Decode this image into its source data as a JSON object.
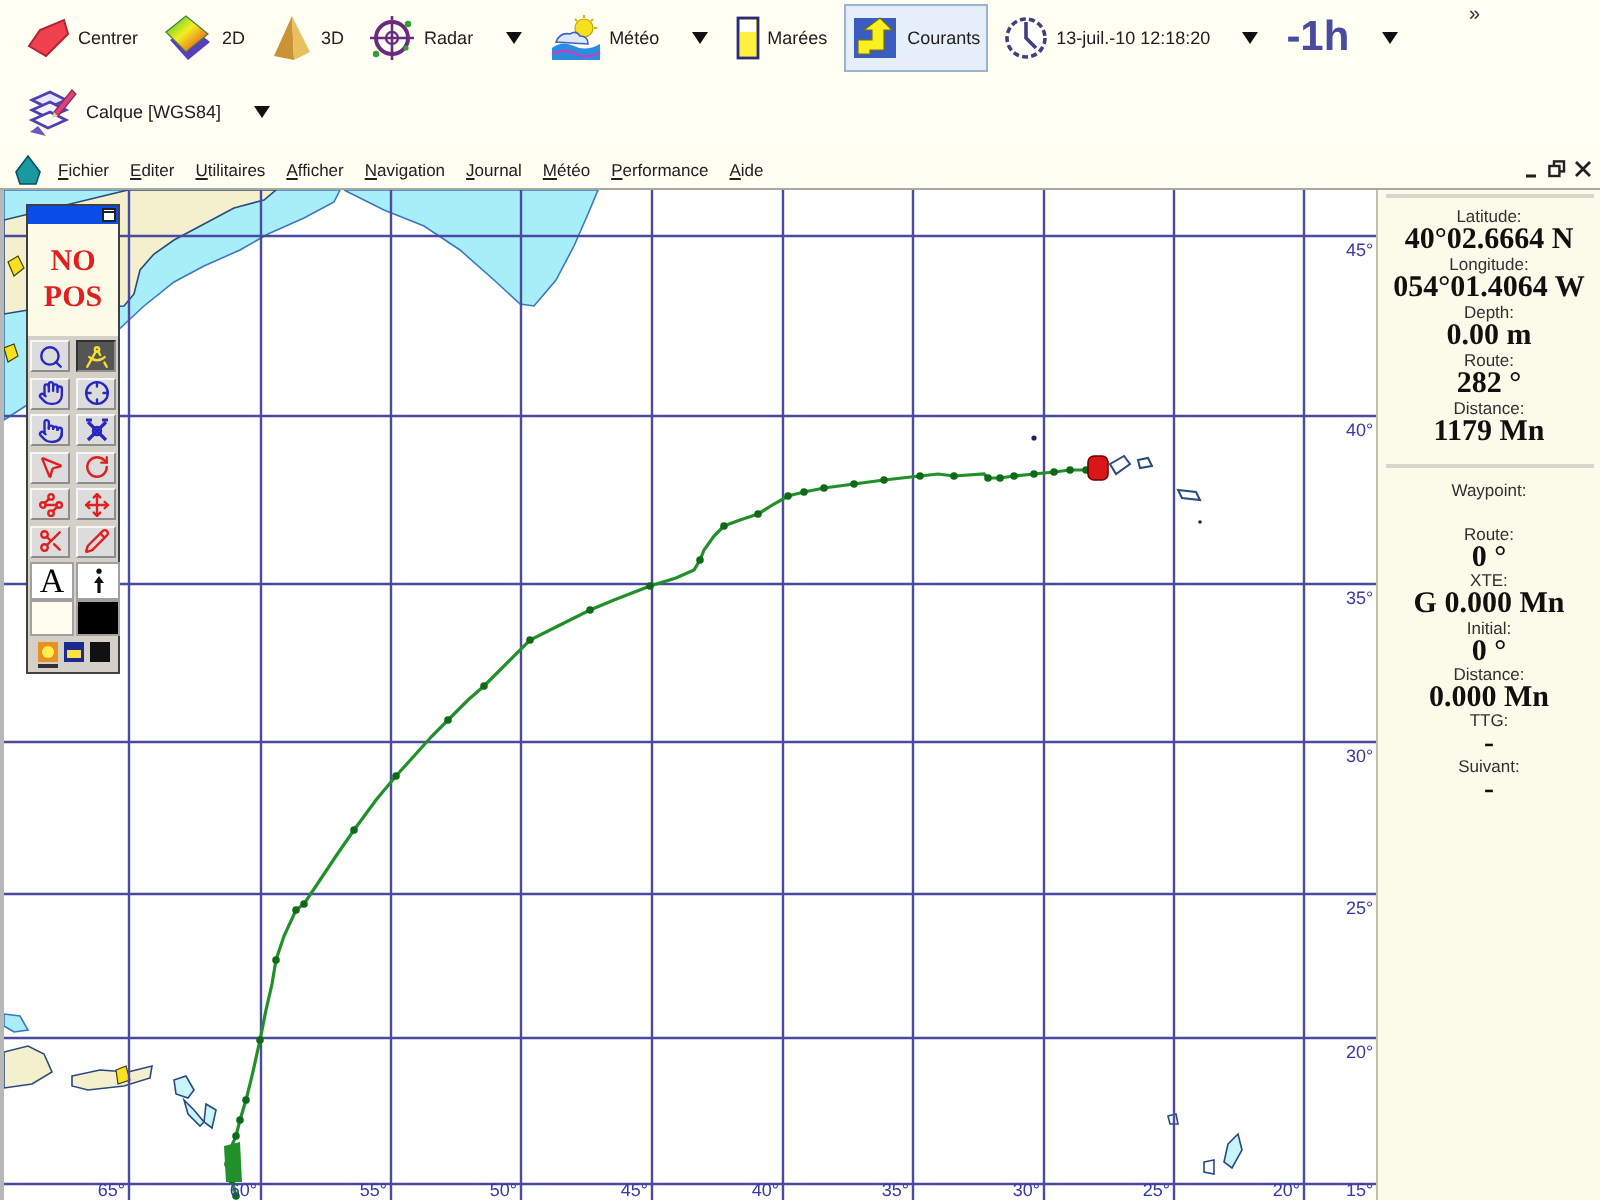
{
  "toolbar": {
    "buttons": [
      {
        "kind": "center",
        "label": "Centrer",
        "dropdown": false,
        "selected": false
      },
      {
        "kind": "chart-2d",
        "label": "2D",
        "dropdown": false,
        "selected": false
      },
      {
        "kind": "chart-3d",
        "label": "3D",
        "dropdown": false,
        "selected": false
      },
      {
        "kind": "radar",
        "label": "Radar",
        "dropdown": true,
        "selected": false
      },
      {
        "kind": "weather",
        "label": "Météo",
        "dropdown": true,
        "selected": false
      },
      {
        "kind": "tides",
        "label": "Marées",
        "dropdown": false,
        "selected": false
      },
      {
        "kind": "currents",
        "label": "Courants",
        "dropdown": false,
        "selected": true
      },
      {
        "kind": "clock",
        "label": "13-juil.-10 12:18:20",
        "dropdown": true,
        "selected": false
      },
      {
        "kind": "offset",
        "label": "-1h",
        "dropdown": true,
        "selected": false
      }
    ],
    "overflow": "»",
    "second_row": [
      {
        "kind": "layer",
        "label": "Calque [WGS84]",
        "dropdown": true,
        "selected": false
      }
    ]
  },
  "menu": {
    "items": [
      "Fichier",
      "Editer",
      "Utilitaires",
      "Afficher",
      "Navigation",
      "Journal",
      "Météo",
      "Performance",
      "Aide"
    ]
  },
  "map": {
    "longitude_labels": [
      "65°",
      "60°",
      "55°",
      "50°",
      "45°",
      "40°",
      "35°",
      "30°",
      "25°",
      "20°"
    ],
    "latitude_labels": [
      "45°",
      "40°",
      "35°",
      "30°",
      "25°",
      "20°",
      "15°"
    ]
  },
  "palette": {
    "status": "NO POS",
    "tools": [
      {
        "kind": "zoom",
        "selected": false
      },
      {
        "kind": "dividers",
        "selected": true
      },
      {
        "kind": "pan",
        "selected": false
      },
      {
        "kind": "center",
        "selected": false
      },
      {
        "kind": "point",
        "selected": false
      },
      {
        "kind": "mark",
        "selected": false
      },
      {
        "kind": "arrow",
        "selected": false
      },
      {
        "kind": "rotate",
        "selected": false
      },
      {
        "kind": "waypoints",
        "selected": false
      },
      {
        "kind": "move",
        "selected": false
      },
      {
        "kind": "cut",
        "selected": false
      },
      {
        "kind": "pencil",
        "selected": false
      }
    ],
    "text_tool": "A",
    "swatches": [
      {
        "color": "#fffdf0"
      },
      {
        "color": "#000000"
      }
    ],
    "modes": [
      {
        "kind": "day",
        "selected": true
      },
      {
        "kind": "dusk",
        "selected": false
      },
      {
        "kind": "night",
        "selected": false
      }
    ]
  },
  "info_panel": {
    "position": [
      {
        "label": "Latitude:",
        "value": "40°02.6664 N"
      },
      {
        "label": "Longitude:",
        "value": "054°01.4064 W"
      },
      {
        "label": "Depth:",
        "value": "0.00 m"
      },
      {
        "label": "Route:",
        "value": "282 °"
      },
      {
        "label": "Distance:",
        "value": "1179 Mn"
      }
    ],
    "waypoint": {
      "title": "Waypoint:",
      "readouts": [
        {
          "label": "Route:",
          "value": "0 °"
        },
        {
          "label": "XTE:",
          "value": "G 0.000 Mn"
        },
        {
          "label": "Initial:",
          "value": "0 °"
        },
        {
          "label": "Distance:",
          "value": "0.000 Mn"
        },
        {
          "label": "TTG:",
          "value": "-"
        },
        {
          "label": "Suivant:",
          "value": "-"
        }
      ]
    }
  }
}
